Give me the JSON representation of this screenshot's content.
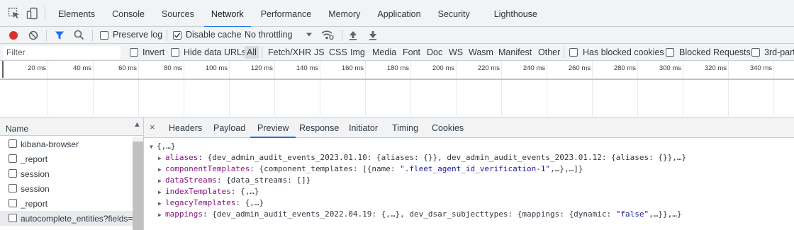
{
  "devtools": {
    "tools": [
      "inspect-element-icon",
      "device-toggle-icon"
    ],
    "tabs": [
      {
        "label": "Elements"
      },
      {
        "label": "Console"
      },
      {
        "label": "Sources"
      },
      {
        "label": "Network",
        "active": true
      },
      {
        "label": "Performance"
      },
      {
        "label": "Memory"
      },
      {
        "label": "Application"
      },
      {
        "label": "Security"
      },
      {
        "label": "Lighthouse"
      }
    ],
    "accent_color": "#1a73e8",
    "record_color": "#d93025"
  },
  "toolbar": {
    "preserve_log_label": "Preserve log",
    "preserve_log_checked": false,
    "disable_cache_label": "Disable cache",
    "disable_cache_checked": true,
    "throttling_value": "No throttling"
  },
  "filterbar": {
    "filter_placeholder": "Filter",
    "invert_label": "Invert",
    "hide_data_urls_label": "Hide data URLs",
    "types": [
      "All",
      "Fetch/XHR",
      "JS",
      "CSS",
      "Img",
      "Media",
      "Font",
      "Doc",
      "WS",
      "Wasm",
      "Manifest",
      "Other"
    ],
    "active_type": "All",
    "has_blocked_cookies_label": "Has blocked cookies",
    "blocked_requests_label": "Blocked Requests",
    "third_party_label": "3rd-part"
  },
  "overview": {
    "ticks": [
      "20 ms",
      "40 ms",
      "60 ms",
      "80 ms",
      "100 ms",
      "120 ms",
      "140 ms",
      "160 ms",
      "180 ms",
      "200 ms",
      "220 ms",
      "240 ms",
      "260 ms",
      "280 ms",
      "300 ms",
      "320 ms",
      "340 ms"
    ]
  },
  "requests": {
    "column_header": "Name",
    "rows": [
      {
        "name": "kibana-browser"
      },
      {
        "name": "_report"
      },
      {
        "name": "session"
      },
      {
        "name": "session"
      },
      {
        "name": "_report"
      },
      {
        "name": "autocomplete_entities?fields=",
        "selected": true
      }
    ]
  },
  "details": {
    "close_label": "×",
    "tabs": [
      {
        "label": "Headers"
      },
      {
        "label": "Payload"
      },
      {
        "label": "Preview",
        "active": true
      },
      {
        "label": "Response"
      },
      {
        "label": "Initiator"
      },
      {
        "label": "Timing"
      },
      {
        "label": "Cookies"
      }
    ],
    "preview": {
      "root": "{,…}",
      "lines": [
        {
          "key": "aliases",
          "value_pre": "{dev_admin_audit_events_2023.01.10: {aliases: {}}, dev_admin_audit_events_2023.01.12: {aliases: {}},…}"
        },
        {
          "key": "componentTemplates",
          "value_pre": "{component_templates: [{name: ",
          "value_str": "\".fleet_agent_id_verification-1\"",
          "value_post": ",…},…]}"
        },
        {
          "key": "dataStreams",
          "value_pre": "{data_streams: []}"
        },
        {
          "key": "indexTemplates",
          "value_pre": "{,…}"
        },
        {
          "key": "legacyTemplates",
          "value_pre": "{,…}"
        },
        {
          "key": "mappings",
          "value_pre": "{dev_admin_audit_events_2022.04.19: {,…}, dev_dsar_subjecttypes: {mappings: {dynamic: ",
          "value_str": "\"false\"",
          "value_post": ",…}},…}"
        }
      ]
    }
  }
}
